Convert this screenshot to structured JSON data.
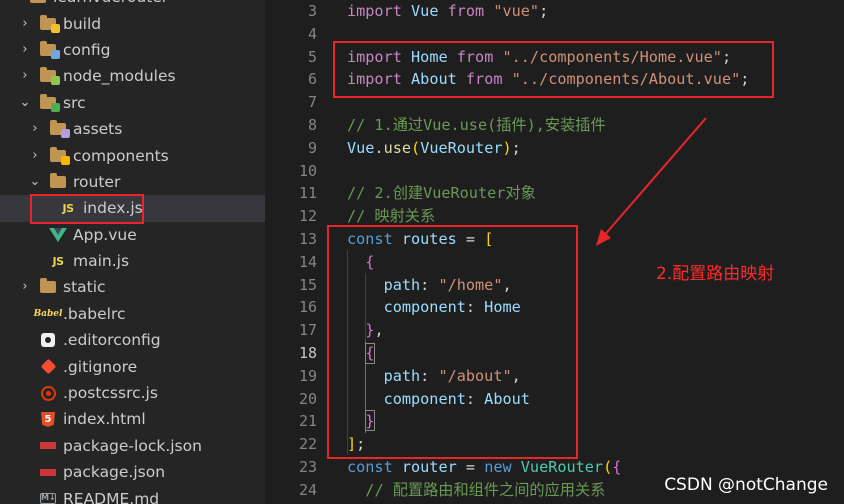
{
  "sidebar": {
    "items": [
      {
        "label": "learnvuerouter",
        "icon": "folder-open-icon",
        "kind": "root"
      },
      {
        "label": "build",
        "icon": "folder-build-icon",
        "kind": "folder",
        "expanded": false
      },
      {
        "label": "config",
        "icon": "folder-config-icon",
        "kind": "folder",
        "expanded": false
      },
      {
        "label": "node_modules",
        "icon": "folder-node-icon",
        "kind": "folder",
        "expanded": false
      },
      {
        "label": "src",
        "icon": "folder-src-icon",
        "kind": "folder",
        "expanded": true
      },
      {
        "label": "assets",
        "icon": "folder-assets-icon",
        "kind": "folder",
        "expanded": false
      },
      {
        "label": "components",
        "icon": "folder-components-icon",
        "kind": "folder",
        "expanded": false
      },
      {
        "label": "router",
        "icon": "folder-open-icon",
        "kind": "folder",
        "expanded": true
      },
      {
        "label": "index.js",
        "icon": "js-file-icon",
        "kind": "file",
        "selected": true
      },
      {
        "label": "App.vue",
        "icon": "vue-file-icon",
        "kind": "file"
      },
      {
        "label": "main.js",
        "icon": "js-file-icon",
        "kind": "file"
      },
      {
        "label": "static",
        "icon": "folder-icon",
        "kind": "folder",
        "expanded": false
      },
      {
        "label": ".babelrc",
        "icon": "babel-icon",
        "kind": "file"
      },
      {
        "label": ".editorconfig",
        "icon": "editorconfig-icon",
        "kind": "file"
      },
      {
        "label": ".gitignore",
        "icon": "git-icon",
        "kind": "file"
      },
      {
        "label": ".postcssrc.js",
        "icon": "postcss-icon",
        "kind": "file"
      },
      {
        "label": "index.html",
        "icon": "html5-icon",
        "kind": "file"
      },
      {
        "label": "package-lock.json",
        "icon": "npm-icon",
        "kind": "file"
      },
      {
        "label": "package.json",
        "icon": "npm-icon",
        "kind": "file"
      },
      {
        "label": "README.md",
        "icon": "markdown-icon",
        "kind": "file"
      }
    ]
  },
  "editor": {
    "active_line": 18,
    "lines": [
      {
        "n": "3",
        "tokens": [
          [
            "kw2",
            "import"
          ],
          [
            "txt",
            " "
          ],
          [
            "var",
            "Vue"
          ],
          [
            "txt",
            " "
          ],
          [
            "kw2",
            "from"
          ],
          [
            "txt",
            " "
          ],
          [
            "str",
            "\"vue\""
          ],
          [
            "txt",
            ";"
          ]
        ]
      },
      {
        "n": "4",
        "tokens": []
      },
      {
        "n": "5",
        "tokens": [
          [
            "kw2",
            "import"
          ],
          [
            "txt",
            " "
          ],
          [
            "var",
            "Home"
          ],
          [
            "txt",
            " "
          ],
          [
            "kw2",
            "from"
          ],
          [
            "txt",
            " "
          ],
          [
            "str",
            "\"../components/Home.vue\""
          ],
          [
            "txt",
            ";"
          ]
        ]
      },
      {
        "n": "6",
        "tokens": [
          [
            "kw2",
            "import"
          ],
          [
            "txt",
            " "
          ],
          [
            "var",
            "About"
          ],
          [
            "txt",
            " "
          ],
          [
            "kw2",
            "from"
          ],
          [
            "txt",
            " "
          ],
          [
            "str",
            "\"../components/About.vue\""
          ],
          [
            "txt",
            ";"
          ]
        ]
      },
      {
        "n": "7",
        "tokens": []
      },
      {
        "n": "8",
        "tokens": [
          [
            "cmt",
            "// 1.通过Vue.use(插件),安装插件"
          ]
        ]
      },
      {
        "n": "9",
        "tokens": [
          [
            "var",
            "Vue"
          ],
          [
            "txt",
            "."
          ],
          [
            "fn",
            "use"
          ],
          [
            "br1",
            "("
          ],
          [
            "var",
            "VueRouter"
          ],
          [
            "br1",
            ")"
          ],
          [
            "txt",
            ";"
          ]
        ]
      },
      {
        "n": "10",
        "tokens": []
      },
      {
        "n": "11",
        "tokens": [
          [
            "cmt",
            "// 2.创建VueRouter对象"
          ]
        ]
      },
      {
        "n": "12",
        "tokens": [
          [
            "cmt",
            "// 映射关系"
          ]
        ]
      },
      {
        "n": "13",
        "tokens": [
          [
            "kw",
            "const"
          ],
          [
            "txt",
            " "
          ],
          [
            "var",
            "routes"
          ],
          [
            "txt",
            " = "
          ],
          [
            "br1",
            "["
          ]
        ]
      },
      {
        "n": "14",
        "tokens": [
          [
            "txt",
            "  "
          ],
          [
            "br2",
            "{"
          ]
        ]
      },
      {
        "n": "15",
        "tokens": [
          [
            "txt",
            "    "
          ],
          [
            "var",
            "path"
          ],
          [
            "txt",
            ": "
          ],
          [
            "str",
            "\"/home\""
          ],
          [
            "txt",
            ","
          ]
        ]
      },
      {
        "n": "16",
        "tokens": [
          [
            "txt",
            "    "
          ],
          [
            "var",
            "component"
          ],
          [
            "txt",
            ": "
          ],
          [
            "var",
            "Home"
          ]
        ]
      },
      {
        "n": "17",
        "tokens": [
          [
            "txt",
            "  "
          ],
          [
            "br2",
            "}"
          ],
          [
            "txt",
            ","
          ]
        ]
      },
      {
        "n": "18",
        "tokens": [
          [
            "txt",
            "  "
          ],
          [
            "br2",
            "{"
          ]
        ]
      },
      {
        "n": "19",
        "tokens": [
          [
            "txt",
            "    "
          ],
          [
            "var",
            "path"
          ],
          [
            "txt",
            ": "
          ],
          [
            "str",
            "\"/about\""
          ],
          [
            "txt",
            ","
          ]
        ]
      },
      {
        "n": "20",
        "tokens": [
          [
            "txt",
            "    "
          ],
          [
            "var",
            "component"
          ],
          [
            "txt",
            ": "
          ],
          [
            "var",
            "About"
          ]
        ]
      },
      {
        "n": "21",
        "tokens": [
          [
            "txt",
            "  "
          ],
          [
            "br2",
            "}"
          ]
        ]
      },
      {
        "n": "22",
        "tokens": [
          [
            "br1",
            "]"
          ],
          [
            "txt",
            ";"
          ]
        ]
      },
      {
        "n": "23",
        "tokens": [
          [
            "kw",
            "const"
          ],
          [
            "txt",
            " "
          ],
          [
            "var",
            "router"
          ],
          [
            "txt",
            " = "
          ],
          [
            "kw",
            "new"
          ],
          [
            "txt",
            " "
          ],
          [
            "cls",
            "VueRouter"
          ],
          [
            "br1",
            "("
          ],
          [
            "br2",
            "{"
          ]
        ]
      },
      {
        "n": "24",
        "tokens": [
          [
            "txt",
            "  "
          ],
          [
            "cmt",
            "// 配置路由和组件之间的应用关系"
          ]
        ]
      }
    ]
  },
  "annotation": {
    "label": "2.配置路由映射",
    "color": "#e8262a"
  },
  "watermark": "CSDN @notChange"
}
